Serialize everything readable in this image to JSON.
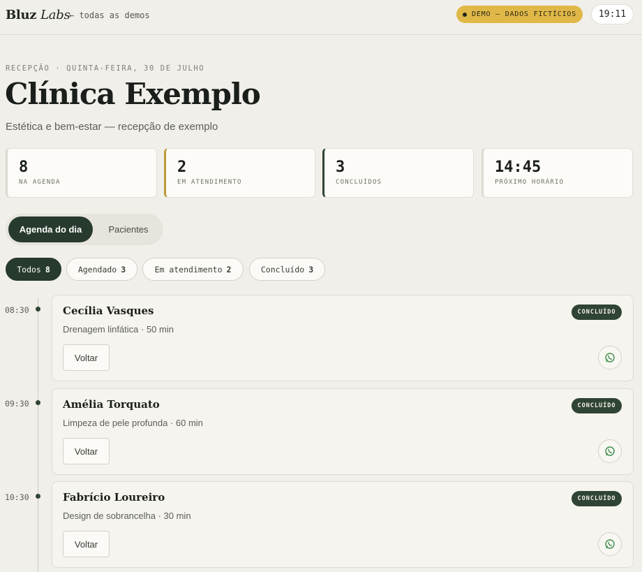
{
  "topbar": {
    "logo_main": "Bluz",
    "logo_italic": "Labs",
    "back_link": "← todas as demos",
    "demo_badge": "DEMO — DADOS FICTÍCIOS",
    "clock": "19:11"
  },
  "header": {
    "eyebrow": "RECEPÇÃO · QUINTA-FEIRA, 30 DE JULHO",
    "title": "Clínica Exemplo",
    "subtitle": "Estética e bem-estar — recepção de exemplo"
  },
  "stats": [
    {
      "value": "8",
      "label": "NA AGENDA"
    },
    {
      "value": "2",
      "label": "EM ATENDIMENTO"
    },
    {
      "value": "3",
      "label": "CONCLUÍDOS"
    },
    {
      "value": "14:45",
      "label": "PRÓXIMO HORÁRIO"
    }
  ],
  "tabs": [
    {
      "label": "Agenda do dia",
      "active": true
    },
    {
      "label": "Pacientes",
      "active": false
    }
  ],
  "filters": [
    {
      "label": "Todos",
      "count": "8",
      "active": true
    },
    {
      "label": "Agendado",
      "count": "3",
      "active": false
    },
    {
      "label": "Em atendimento",
      "count": "2",
      "active": false
    },
    {
      "label": "Concluído",
      "count": "3",
      "active": false
    }
  ],
  "appointments": [
    {
      "time": "08:30",
      "name": "Cecília Vasques",
      "service": "Drenagem linfática · 50 min",
      "status": "CONCLUÍDO",
      "action": "Voltar"
    },
    {
      "time": "09:30",
      "name": "Amélia Torquato",
      "service": "Limpeza de pele profunda · 60 min",
      "status": "CONCLUÍDO",
      "action": "Voltar"
    },
    {
      "time": "10:30",
      "name": "Fabrício Loureiro",
      "service": "Design de sobrancelha · 30 min",
      "status": "CONCLUÍDO",
      "action": "Voltar"
    }
  ],
  "icons": {
    "whatsapp": "whatsapp-icon",
    "status_dot": "dot-icon"
  },
  "colors": {
    "accent_dark": "#263a2d",
    "demo_badge": "#e0b847",
    "background": "#f1efe9"
  }
}
